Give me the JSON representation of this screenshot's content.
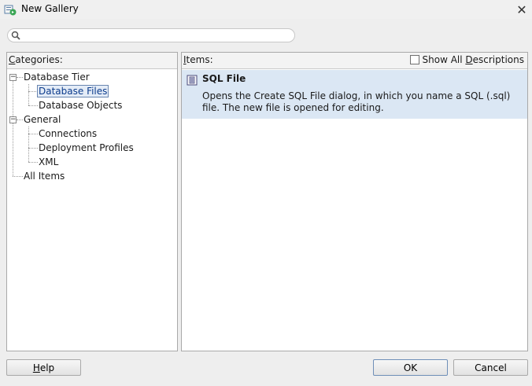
{
  "window": {
    "title": "New Gallery",
    "close_label": "✕"
  },
  "search": {
    "placeholder": "",
    "value": ""
  },
  "categories": {
    "header_prefix": "C",
    "header_rest": "ategories:",
    "tree": {
      "database_tier": "Database Tier",
      "database_files": "Database Files",
      "database_objects": "Database Objects",
      "general": "General",
      "connections": "Connections",
      "deployment_profiles": "Deployment Profiles",
      "xml": "XML",
      "all_items": "All Items"
    },
    "expander_symbol": "−"
  },
  "items": {
    "header_prefix": "I",
    "header_rest": "tems:",
    "show_all_pre": "Show All ",
    "show_all_u": "D",
    "show_all_post": "escriptions",
    "list": [
      {
        "title": "SQL File",
        "description": "Opens the Create SQL File dialog, in which you name a SQL (.sql) file. The new file is opened for editing."
      }
    ]
  },
  "buttons": {
    "help_u": "H",
    "help_rest": "elp",
    "ok": "OK",
    "cancel": "Cancel"
  },
  "colors": {
    "selected_item_bg": "#dbe7f4",
    "selection_outline": "#6a86b0"
  }
}
